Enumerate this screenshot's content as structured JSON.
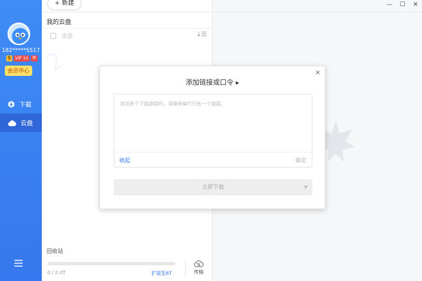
{
  "sidebar": {
    "phone": "182*****5517",
    "vip_badge": "S",
    "vip_level": "VIP 10",
    "vip_extra": "年",
    "member_button": "会员中心",
    "nav": [
      {
        "label": "下载",
        "icon": "download-cube-icon"
      },
      {
        "label": "云盘",
        "icon": "cloud-icon"
      }
    ],
    "menu_icon": "hamburger-menu-icon"
  },
  "panel": {
    "new_button": "+ 新建",
    "title": "我的云盘",
    "select_all": "全选",
    "sort_icon": "sort-icon",
    "recycle": "回收站",
    "storage_text": "0 / 2.0T",
    "storage_fraction": 0,
    "expand_link": "扩容至6T",
    "transfer_label": "传输"
  },
  "window": {
    "minimize": "—",
    "maximize": "☐",
    "close": "✕"
  },
  "dialog": {
    "title": "添加链接或口令",
    "title_arrow": "▸",
    "close": "×",
    "placeholder": "添加多个下载链接时，请确保每行只有一个链接。",
    "collapse": "收起",
    "confirm": "确定",
    "download_button": "立即下载",
    "download_caret": "▼"
  },
  "colors": {
    "sidebar": "#3f8cf6",
    "accent": "#3a7bf5",
    "member_button": "#ffe16a"
  }
}
